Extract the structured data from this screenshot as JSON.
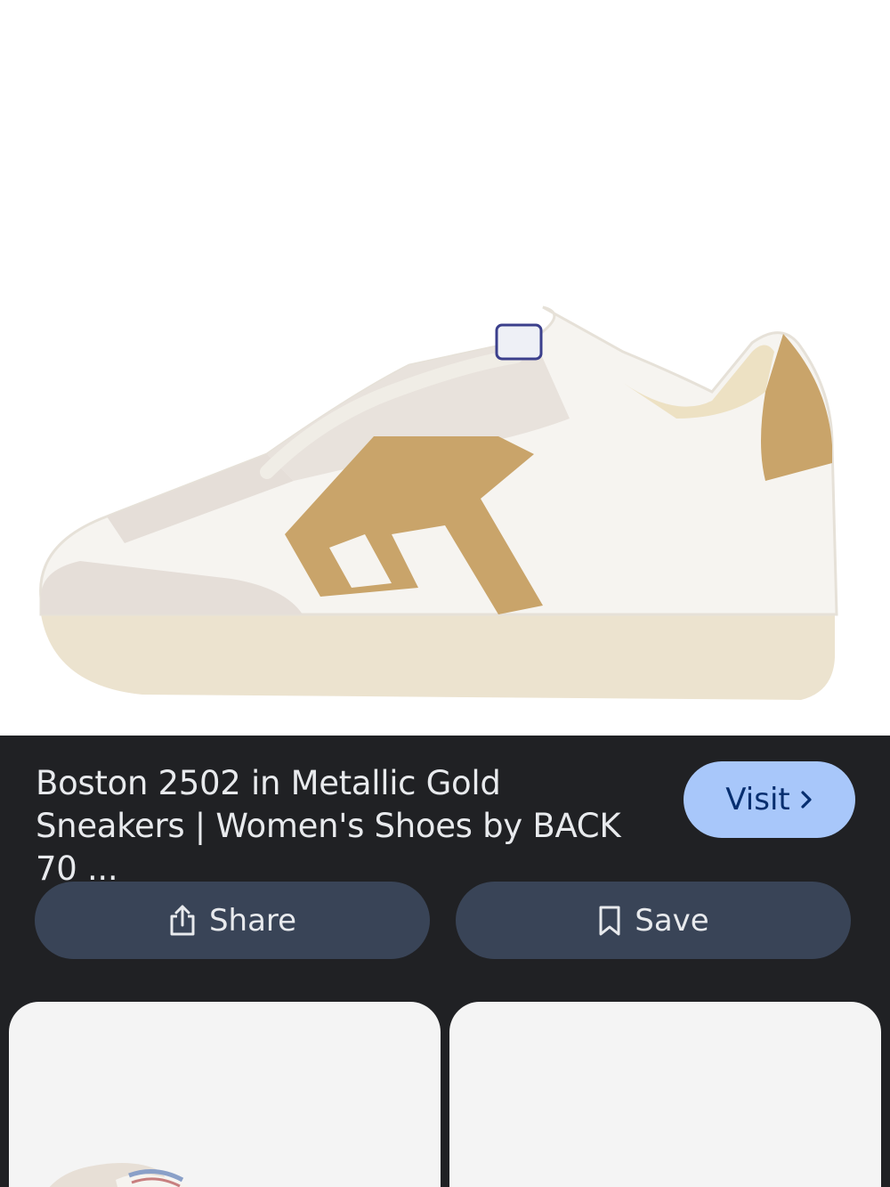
{
  "image": {
    "subject": "sneaker-photo",
    "colors": {
      "upper": "#f6f4f0",
      "suede": "#e5ded8",
      "gold": "#c9a46a",
      "sole": "#ece3cf"
    }
  },
  "result": {
    "title": "Boston 2502 in Metallic Gold Sneakers | Women's Shoes by BACK 70 ...",
    "visit_label": "Visit"
  },
  "actions": {
    "share_label": "Share",
    "save_label": "Save"
  },
  "related": [
    {
      "thumbnail": "sneaker-thumbnail"
    },
    {
      "thumbnail": "blank-thumbnail"
    }
  ],
  "colors": {
    "background": "#202124",
    "accent_button": "#a8c7fa",
    "secondary_button": "#394457",
    "text": "#e8eaed"
  }
}
